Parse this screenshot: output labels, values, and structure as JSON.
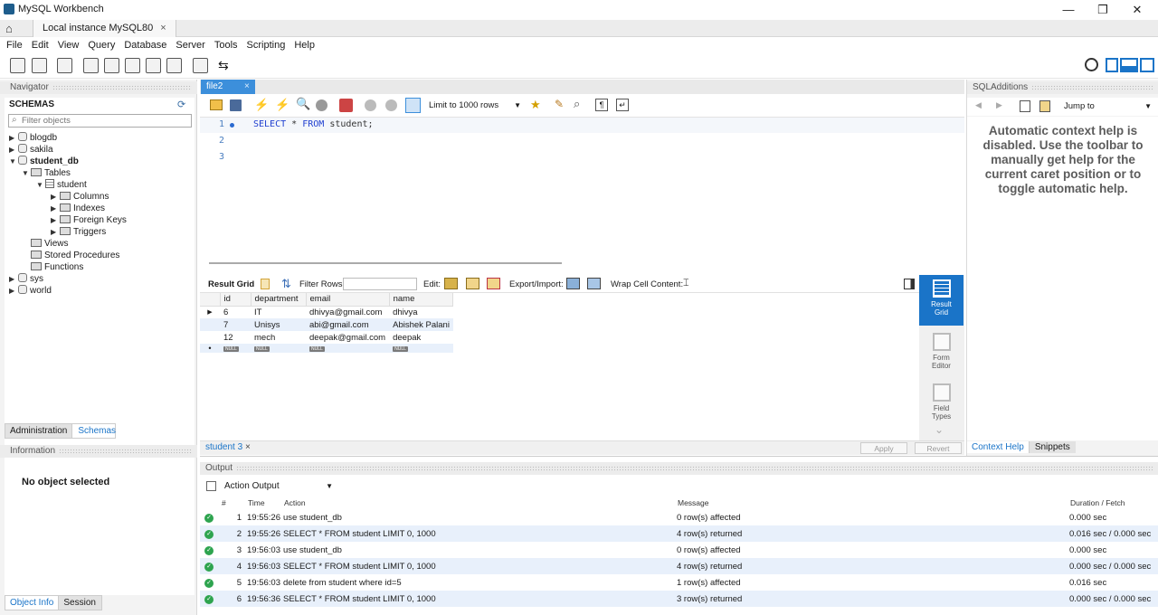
{
  "window": {
    "title": "MySQL Workbench",
    "tab": "Local instance MySQL80",
    "tab_close": "×",
    "minimize": "—",
    "restore": "❐",
    "close": "✕"
  },
  "menu": [
    "File",
    "Edit",
    "View",
    "Query",
    "Database",
    "Server",
    "Tools",
    "Scripting",
    "Help"
  ],
  "navigator": {
    "header": "Navigator",
    "schemas_label": "SCHEMAS",
    "filter_placeholder": "Filter objects",
    "tree": {
      "db1": "blogdb",
      "db2": "sakila",
      "db3": "student_db",
      "tables": "Tables",
      "table": "student",
      "columns": "Columns",
      "indexes": "Indexes",
      "foreign_keys": "Foreign Keys",
      "triggers": "Triggers",
      "views": "Views",
      "procedures": "Stored Procedures",
      "functions": "Functions",
      "db4": "sys",
      "db5": "world"
    },
    "tab_admin": "Administration",
    "tab_schemas": "Schemas",
    "info_header": "Information",
    "no_object": "No object selected",
    "tab_object_info": "Object Info",
    "tab_session": "Session"
  },
  "editor": {
    "file_tab": "file2",
    "file_tab_close": "×",
    "limit_label": "Limit to 1000 rows",
    "lines": [
      {
        "num": "1",
        "code": "SELECT * FROM student;"
      },
      {
        "num": "2",
        "code": ""
      },
      {
        "num": "3",
        "code": ""
      }
    ]
  },
  "result": {
    "grid_label": "Result Grid",
    "filter_label": "Filter Rows:",
    "edit_label": "Edit:",
    "export_label": "Export/Import:",
    "wrap_label": "Wrap Cell Content:",
    "columns": [
      "id",
      "department",
      "email",
      "name"
    ],
    "rows": [
      [
        "6",
        "IT",
        "dhivya@gmail.com",
        "dhivya"
      ],
      [
        "7",
        "Unisys",
        "abi@gmail.com",
        "Abishek Palani"
      ],
      [
        "12",
        "mech",
        "deepak@gmail.com",
        "deepak"
      ]
    ],
    "null_text": "NULL",
    "tab": "student 3",
    "tab_close": "×",
    "apply": "Apply",
    "revert": "Revert",
    "side": {
      "result_grid_line1": "Result",
      "result_grid_line2": "Grid",
      "form_editor_line1": "Form",
      "form_editor_line2": "Editor",
      "field_types_line1": "Field",
      "field_types_line2": "Types"
    }
  },
  "sql_additions": {
    "header": "SQLAdditions",
    "jump_to": "Jump to",
    "help_text": "Automatic context help is disabled. Use the toolbar to manually get help for the current caret position or to toggle automatic help.",
    "tab_context_help": "Context Help",
    "tab_snippets": "Snippets"
  },
  "output": {
    "header": "Output",
    "selector": "Action Output",
    "columns": {
      "num": "#",
      "time": "Time",
      "action": "Action",
      "message": "Message",
      "duration": "Duration / Fetch"
    },
    "rows": [
      {
        "num": "1",
        "time": "19:55:26",
        "action": "use student_db",
        "message": "0 row(s) affected",
        "duration": "0.000 sec"
      },
      {
        "num": "2",
        "time": "19:55:26",
        "action": "SELECT * FROM student LIMIT 0, 1000",
        "message": "4 row(s) returned",
        "duration": "0.016 sec / 0.000 sec"
      },
      {
        "num": "3",
        "time": "19:56:03",
        "action": "use student_db",
        "message": "0 row(s) affected",
        "duration": "0.000 sec"
      },
      {
        "num": "4",
        "time": "19:56:03",
        "action": "SELECT * FROM student LIMIT 0, 1000",
        "message": "4 row(s) returned",
        "duration": "0.000 sec / 0.000 sec"
      },
      {
        "num": "5",
        "time": "19:56:03",
        "action": "delete from student where id=5",
        "message": "1 row(s) affected",
        "duration": "0.016 sec"
      },
      {
        "num": "6",
        "time": "19:56:36",
        "action": "SELECT * FROM student LIMIT 0, 1000",
        "message": "3 row(s) returned",
        "duration": "0.000 sec / 0.000 sec"
      }
    ]
  },
  "colors": {
    "accent": "#1a74c8",
    "tab_active": "#3c8fdb",
    "ok": "#2ea44f",
    "stripe": "#e8f0fb"
  }
}
